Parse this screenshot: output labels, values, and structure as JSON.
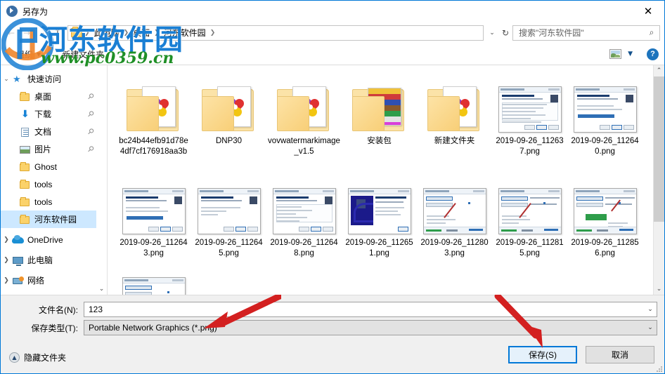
{
  "window": {
    "title": "另存为",
    "close_label": "✕"
  },
  "address_bar": {
    "back_icon": "back-arrow-icon",
    "forward_icon": "forward-arrow-icon",
    "history_icon": "chevron-down-icon",
    "up_icon": "up-arrow-icon",
    "breadcrumbs": [
      "此电脑",
      "桌面",
      "河东软件园"
    ],
    "separator": "❯",
    "dropdown_icon": "chevron-down-icon",
    "refresh_icon": "refresh-icon",
    "refresh_glyph": "↻"
  },
  "search": {
    "placeholder": "搜索\"河东软件园\"",
    "icon_glyph": "⌕"
  },
  "toolbar": {
    "organize_label": "组织",
    "organize_caret": "▼",
    "new_folder_label": "新建文件夹",
    "view_caret": "▼",
    "help_label": "?"
  },
  "sidebar": {
    "groups": [
      {
        "label": "快速访问",
        "icon": "star-pin-icon",
        "expander": "⌄",
        "expanded": true,
        "children": [
          {
            "label": "桌面",
            "icon": "folder-icon",
            "pinned": true
          },
          {
            "label": "下载",
            "icon": "download-icon",
            "pinned": true
          },
          {
            "label": "文档",
            "icon": "document-icon",
            "pinned": true
          },
          {
            "label": "图片",
            "icon": "pictures-icon",
            "pinned": true
          },
          {
            "label": "Ghost",
            "icon": "folder-icon",
            "pinned": false
          },
          {
            "label": "tools",
            "icon": "folder-icon",
            "pinned": false
          },
          {
            "label": "tools",
            "icon": "folder-icon",
            "pinned": false
          },
          {
            "label": "河东软件园",
            "icon": "folder-icon",
            "pinned": false,
            "selected": true
          }
        ]
      },
      {
        "label": "OneDrive",
        "icon": "cloud-icon",
        "expander": "❯",
        "expanded": false,
        "children": []
      },
      {
        "label": "此电脑",
        "icon": "computer-icon",
        "expander": "❯",
        "expanded": false,
        "children": []
      },
      {
        "label": "网络",
        "icon": "network-icon",
        "expander": "❯",
        "expanded": false,
        "children": []
      }
    ],
    "pin_glyph": "📌",
    "scroll_down_glyph": "⌄"
  },
  "file_pane": {
    "items": [
      {
        "name": "bc24b44efb91d78e4df7cf176918aa3b",
        "kind": "folder",
        "thumb": "pinwheel"
      },
      {
        "name": "DNP30",
        "kind": "folder",
        "thumb": "pinwheel"
      },
      {
        "name": "vovwatermarkimage_v1.5",
        "kind": "folder",
        "thumb": "pinwheel"
      },
      {
        "name": "安装包",
        "kind": "folder",
        "thumb": "stripes"
      },
      {
        "name": "新建文件夹",
        "kind": "folder",
        "thumb": "pinwheel"
      },
      {
        "name": "2019-09-26_112637.png",
        "kind": "image",
        "thumb": "setup-license"
      },
      {
        "name": "2019-09-26_112640.png",
        "kind": "image",
        "thumb": "setup-destination"
      },
      {
        "name": "2019-09-26_112643.png",
        "kind": "image",
        "thumb": "setup-destination"
      },
      {
        "name": "2019-09-26_112645.png",
        "kind": "image",
        "thumb": "setup-tasks"
      },
      {
        "name": "2019-09-26_112648.png",
        "kind": "image",
        "thumb": "setup-ready"
      },
      {
        "name": "2019-09-26_112651.png",
        "kind": "image",
        "thumb": "setup-complete"
      },
      {
        "name": "2019-09-26_112803.png",
        "kind": "image",
        "thumb": "app-window"
      },
      {
        "name": "2019-09-26_112815.png",
        "kind": "image",
        "thumb": "app-window"
      },
      {
        "name": "2019-09-26_112856.png",
        "kind": "image",
        "thumb": "app-window-green"
      }
    ],
    "scroll_up_glyph": "⌃",
    "scroll_down_glyph": "⌄"
  },
  "form": {
    "filename_label": "文件名(N):",
    "filename_value": "123",
    "filetype_label": "保存类型(T):",
    "filetype_value": "Portable Network Graphics (*.png)",
    "caret": "⌄",
    "hide_folders_label": "隐藏文件夹",
    "hide_folders_glyph": "▲",
    "save_label": "保存(S)",
    "cancel_label": "取消"
  },
  "watermark": {
    "brand_cn": "河东软件园",
    "brand_url": "www.pc0359.cn",
    "brand_color": "#1a7fd4",
    "url_color": "#1f8f26"
  },
  "colors": {
    "accent": "#0078d7",
    "selection": "#cde8ff",
    "arrow_red": "#d32020"
  }
}
